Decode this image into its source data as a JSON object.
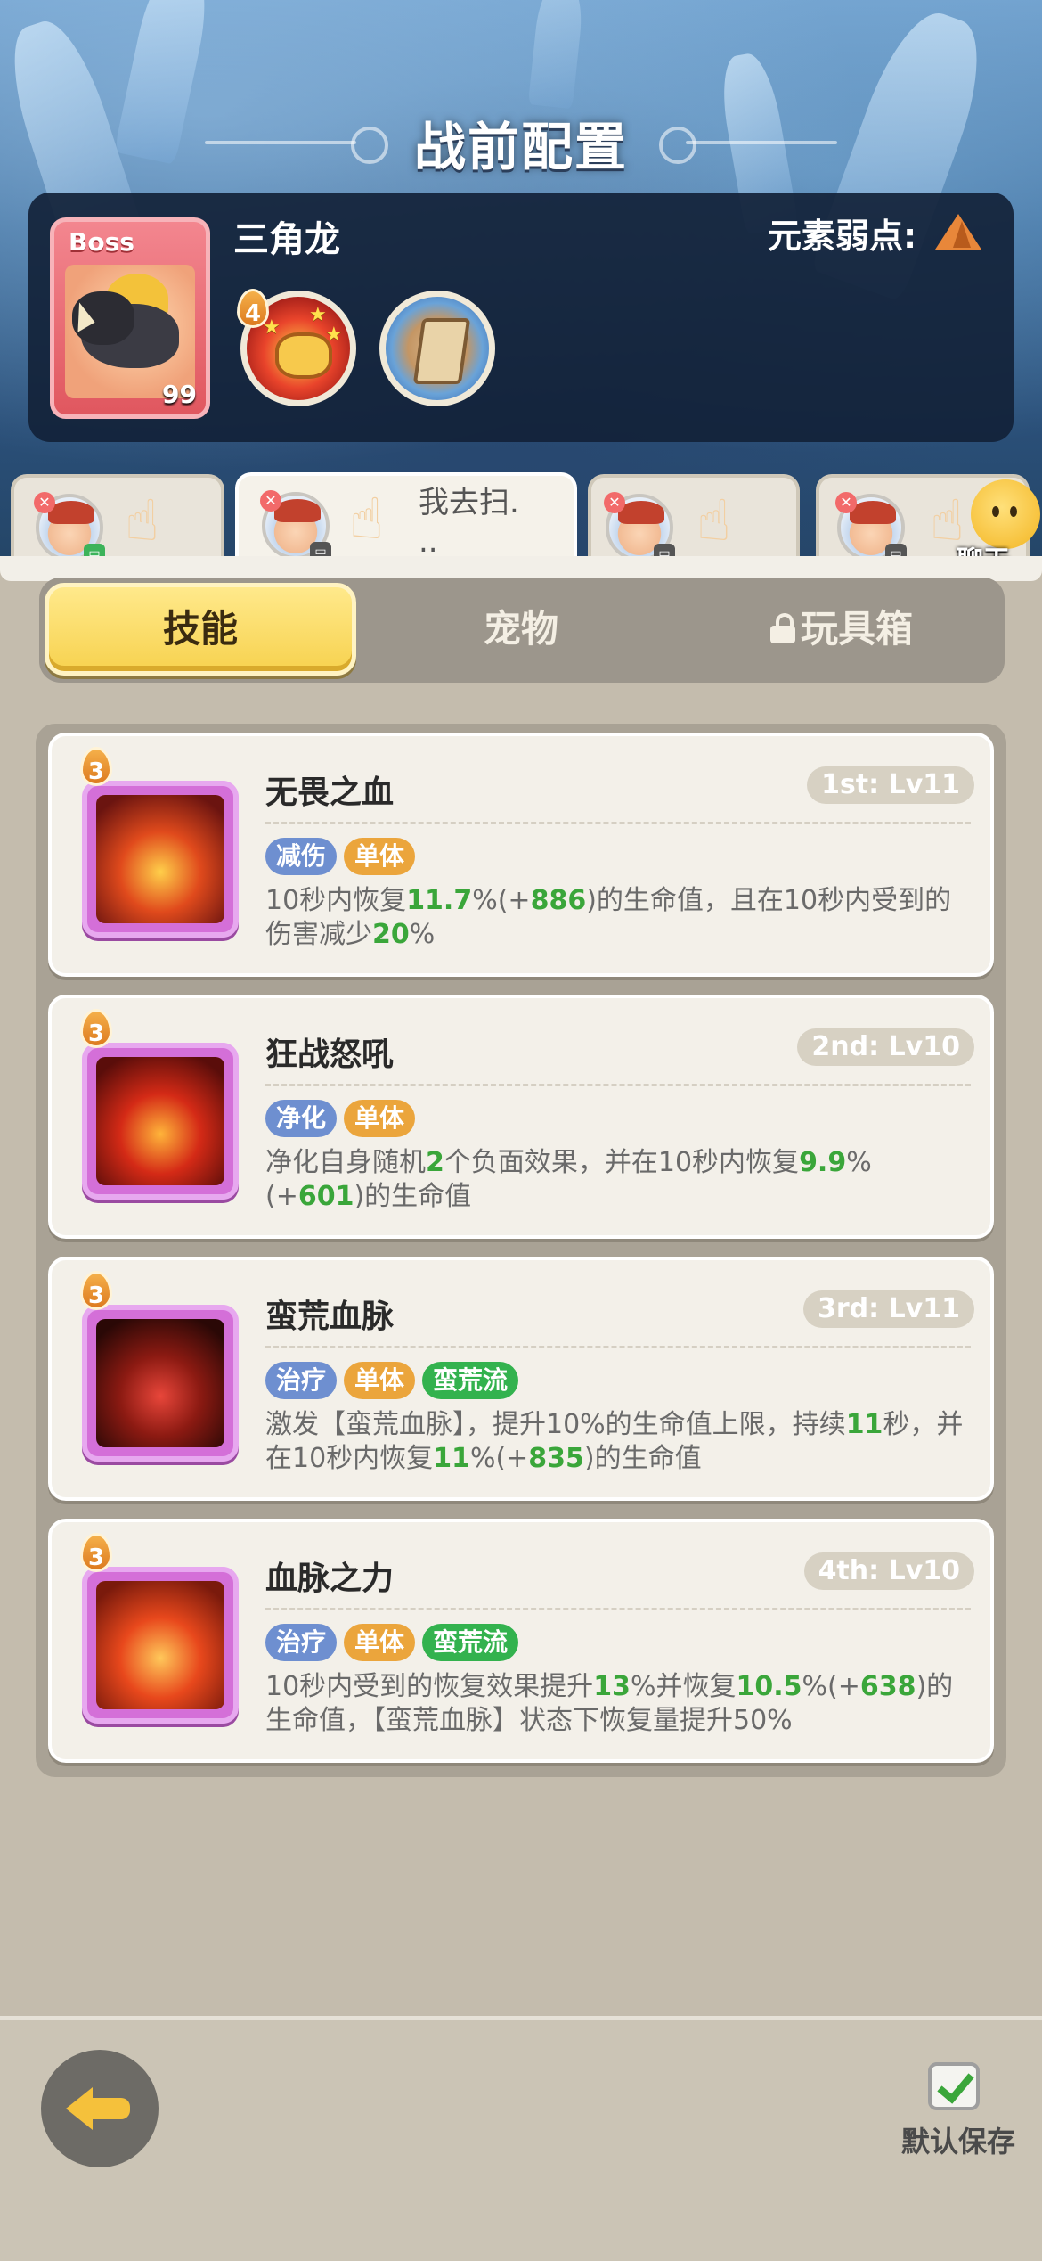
{
  "header": {
    "title": "战前配置"
  },
  "boss": {
    "tag": "Boss",
    "level": "99",
    "name": "三角龙",
    "weakness_label": "元素弱点:",
    "weakness_icon": "earth-element-icon",
    "skills": [
      {
        "icon": "fist-skill-icon",
        "badge": "4"
      },
      {
        "icon": "shield-skill-icon"
      }
    ]
  },
  "team": {
    "active_message": "我去扫.\n..",
    "chat_label": "聊天"
  },
  "type_tabs": {
    "skills": "技能",
    "pets": "宠物",
    "toybox": "玩具箱"
  },
  "skills": [
    {
      "name": "无畏之血",
      "level": "1st: Lv11",
      "badge": "3",
      "tags": [
        {
          "text": "减伤",
          "color": "blue"
        },
        {
          "text": "单体",
          "color": "orange"
        }
      ],
      "desc": [
        {
          "t": "10秒内恢复"
        },
        {
          "t": "11.7",
          "h": true
        },
        {
          "t": "%(+"
        },
        {
          "t": "886",
          "h": true
        },
        {
          "t": ")的生命值，且在10秒内受到的伤害减少"
        },
        {
          "t": "20",
          "h": true
        },
        {
          "t": "%"
        }
      ],
      "icon_colors": [
        "#6b1410",
        "#e04a1c",
        "#ffcf4a"
      ]
    },
    {
      "name": "狂战怒吼",
      "level": "2nd: Lv10",
      "badge": "3",
      "tags": [
        {
          "text": "净化",
          "color": "blue"
        },
        {
          "text": "单体",
          "color": "orange"
        }
      ],
      "desc": [
        {
          "t": "净化自身随机"
        },
        {
          "t": "2",
          "h": true
        },
        {
          "t": "个负面效果，并在10秒内恢复"
        },
        {
          "t": "9.9",
          "h": true
        },
        {
          "t": "%(+"
        },
        {
          "t": "601",
          "h": true
        },
        {
          "t": ")的生命值"
        }
      ],
      "icon_colors": [
        "#5a0d0a",
        "#d42a16",
        "#ffb43a"
      ]
    },
    {
      "name": "蛮荒血脉",
      "level": "3rd: Lv11",
      "badge": "3",
      "tags": [
        {
          "text": "治疗",
          "color": "blue"
        },
        {
          "text": "单体",
          "color": "orange"
        },
        {
          "text": "蛮荒流",
          "color": "green"
        }
      ],
      "desc": [
        {
          "t": "激发【蛮荒血脉】，提升10%的生命值上限，持续"
        },
        {
          "t": "11",
          "h": true
        },
        {
          "t": "秒，并在10秒内恢复"
        },
        {
          "t": "11",
          "h": true
        },
        {
          "t": "%(+"
        },
        {
          "t": "835",
          "h": true
        },
        {
          "t": ")的生命值"
        }
      ],
      "icon_colors": [
        "#2a0806",
        "#8c1a12",
        "#e8463a"
      ]
    },
    {
      "name": "血脉之力",
      "level": "4th: Lv10",
      "badge": "3",
      "tags": [
        {
          "text": "治疗",
          "color": "blue"
        },
        {
          "text": "单体",
          "color": "orange"
        },
        {
          "text": "蛮荒流",
          "color": "green"
        }
      ],
      "desc": [
        {
          "t": "10秒内受到的恢复效果提升"
        },
        {
          "t": "13",
          "h": true
        },
        {
          "t": "%并恢复"
        },
        {
          "t": "10.5",
          "h": true
        },
        {
          "t": "%(+"
        },
        {
          "t": "638",
          "h": true
        },
        {
          "t": ")的生命值，【蛮荒血脉】状态下恢复量提升50%"
        }
      ],
      "icon_colors": [
        "#7a1a0c",
        "#e8481c",
        "#ffc85a"
      ]
    }
  ],
  "footer": {
    "back_icon": "back-arrow-icon",
    "save_label": "默认保存",
    "save_checked": true
  },
  "colors": {
    "highlight": "#3aa63a",
    "tab_active": "#f7d24f",
    "tag_blue": "#6e8fd0",
    "tag_orange": "#eba53c",
    "tag_green": "#33b24e"
  }
}
